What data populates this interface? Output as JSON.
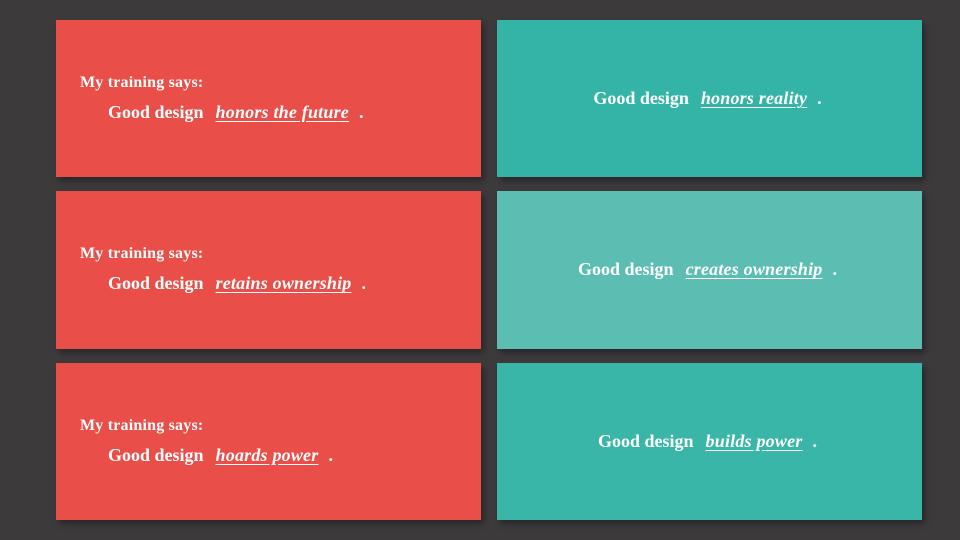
{
  "rows": [
    {
      "left": {
        "pretitle": "My training says:",
        "stem": "Good design",
        "blank": "honors the future",
        "tealClass": "red"
      },
      "right": {
        "stem": "Good design",
        "blank": "honors reality",
        "tealClass": "teal1"
      }
    },
    {
      "left": {
        "pretitle": "My training says:",
        "stem": "Good design",
        "blank": "retains ownership",
        "tealClass": "red"
      },
      "right": {
        "stem": "Good design",
        "blank": "creates ownership",
        "tealClass": "teal2"
      }
    },
    {
      "left": {
        "pretitle": "My training says:",
        "stem": "Good design",
        "blank": "hoards power",
        "tealClass": "red"
      },
      "right": {
        "stem": "Good design",
        "blank": "builds power",
        "tealClass": "teal3"
      }
    }
  ]
}
